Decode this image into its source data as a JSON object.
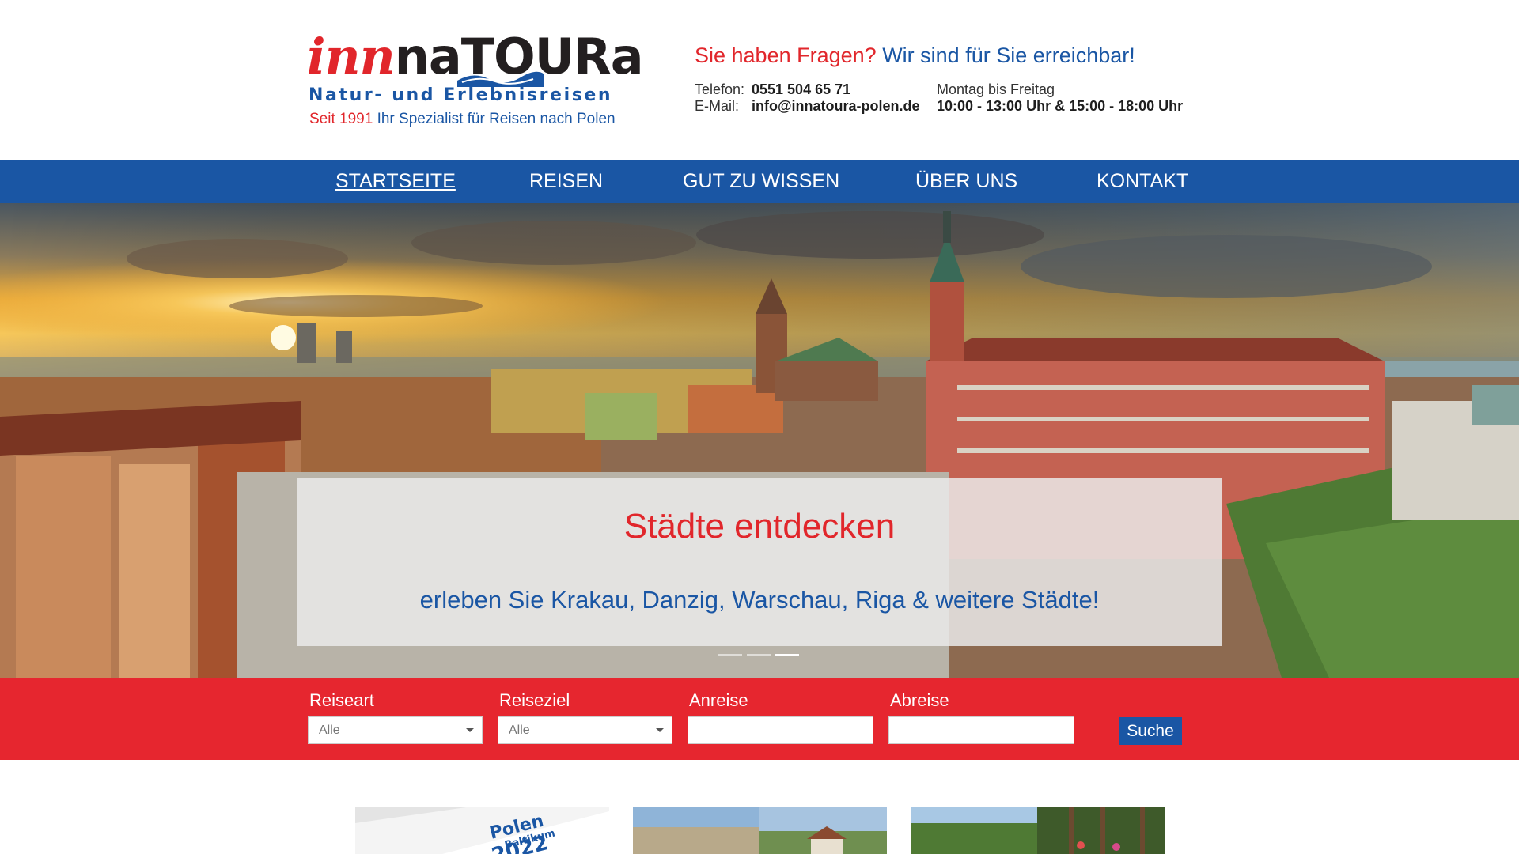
{
  "header": {
    "logo": {
      "word_inn": "inn",
      "word_na": "na",
      "word_tou": "TOU",
      "word_ra": "Ra",
      "subtitle": "Natur- und Erlebnisreisen",
      "since_red": "Seit 1991",
      "since_blue": "Ihr Spezialist für Reisen nach Polen"
    },
    "contact": {
      "question": "Sie haben Fragen?",
      "answer": "Wir sind für Sie erreichbar!",
      "phone_label": "Telefon:",
      "phone_value": "0551 504 65 71",
      "email_label": "E-Mail:",
      "email_value": "info@innatoura-polen.de",
      "days": "Montag bis Freitag",
      "hours": "10:00 - 13:00 Uhr & 15:00 - 18:00 Uhr"
    }
  },
  "nav": {
    "items": [
      {
        "label": "STARTSEITE",
        "active": true
      },
      {
        "label": "REISEN",
        "active": false
      },
      {
        "label": "GUT ZU WISSEN",
        "active": false
      },
      {
        "label": "ÜBER UNS",
        "active": false
      },
      {
        "label": "KONTAKT",
        "active": false
      }
    ]
  },
  "hero": {
    "title": "Städte entdecken",
    "subtitle": "erleben Sie Krakau, Danzig, Warschau, Riga & weitere Städte!",
    "slides_total": 3,
    "active_slide": 3
  },
  "search": {
    "reiseart_label": "Reiseart",
    "reiseart_value": "Alle",
    "reiseziel_label": "Reiseziel",
    "reiseziel_value": "Alle",
    "anreise_label": "Anreise",
    "anreise_value": "",
    "abreise_label": "Abreise",
    "abreise_value": "",
    "submit_label": "Suche"
  },
  "cards": {
    "catalog_title": "Polen",
    "catalog_subtitle": "Baltikum",
    "catalog_year": "2022"
  },
  "colors": {
    "brand_blue": "#1a56a4",
    "brand_red": "#e1262b",
    "search_red": "#e6262f"
  }
}
